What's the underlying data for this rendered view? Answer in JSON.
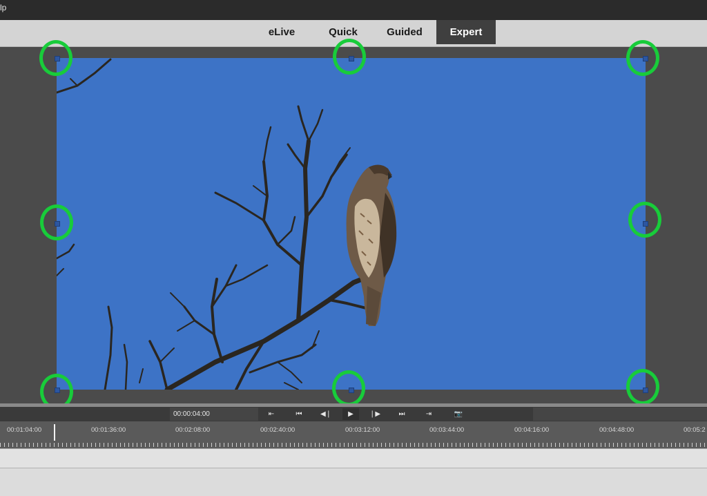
{
  "window": {
    "menu_fragment": "lp"
  },
  "mode_tabs": [
    {
      "label": "eLive",
      "active": false
    },
    {
      "label": "Quick",
      "active": false
    },
    {
      "label": "Guided",
      "active": false
    },
    {
      "label": "Expert",
      "active": true
    }
  ],
  "preview": {
    "description_icon": "bird-on-branch-photo"
  },
  "transport": {
    "timecode": "00:00:04:00",
    "buttons": [
      {
        "name": "go-to-start-icon",
        "glyph": "⇤"
      },
      {
        "name": "previous-clip-icon",
        "glyph": "⏮"
      },
      {
        "name": "step-back-icon",
        "glyph": "◀❘"
      },
      {
        "name": "play-icon",
        "glyph": "▶"
      },
      {
        "name": "step-forward-icon",
        "glyph": "❘▶"
      },
      {
        "name": "next-clip-icon",
        "glyph": "⏭"
      },
      {
        "name": "go-to-end-icon",
        "glyph": "⇥"
      },
      {
        "name": "snapshot-camera-icon",
        "glyph": "📷"
      }
    ]
  },
  "timeline": {
    "ruler_labels": [
      "00:01:04:00",
      "00:01:36:00",
      "00:02:08:00",
      "00:02:40:00",
      "00:03:12:00",
      "00:03:44:00",
      "00:04:16:00",
      "00:04:48:00",
      "00:05:2"
    ]
  },
  "colors": {
    "highlight_ring": "#18cc3a",
    "sky": "#3d73c6",
    "active_tab": "#3f3f3f"
  }
}
